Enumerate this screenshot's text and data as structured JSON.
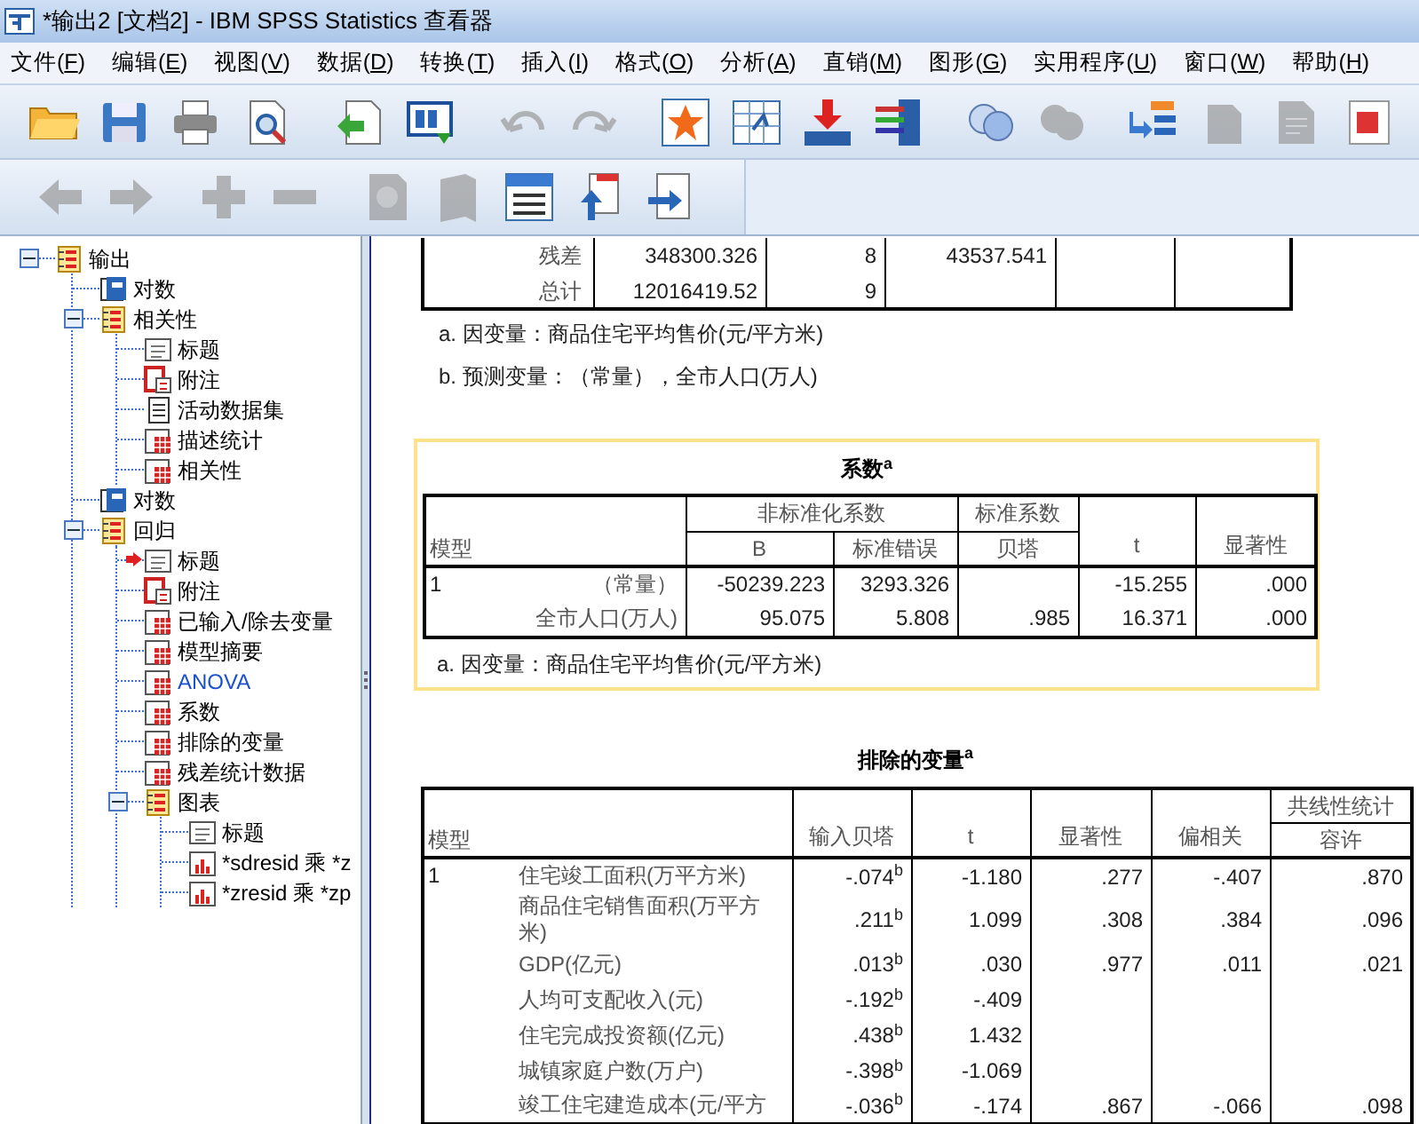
{
  "window": {
    "title": "*输出2 [文档2] - IBM SPSS Statistics 查看器"
  },
  "menu": [
    "文件(F)",
    "编辑(E)",
    "视图(V)",
    "数据(D)",
    "转换(T)",
    "插入(I)",
    "格式(O)",
    "分析(A)",
    "直销(M)",
    "图形(G)",
    "实用程序(U)",
    "窗口(W)",
    "帮助(H)"
  ],
  "toolbar_main": [
    {
      "disabled": false
    },
    {
      "disabled": false
    },
    {
      "disabled": false
    },
    {
      "disabled": false
    },
    {
      "disabled": false
    },
    {
      "disabled": false
    },
    {
      "disabled": true
    },
    {
      "disabled": true
    },
    {
      "disabled": false
    },
    {
      "disabled": false
    },
    {
      "disabled": false
    },
    {
      "disabled": false
    },
    {
      "disabled": false
    },
    {
      "disabled": true
    },
    {
      "disabled": false
    },
    {
      "disabled": true
    },
    {
      "disabled": true
    },
    {
      "disabled": false
    }
  ],
  "toolbar_nav": [
    {
      "disabled": true
    },
    {
      "disabled": true
    },
    {
      "disabled": true
    },
    {
      "disabled": true
    },
    {
      "disabled": true
    },
    {
      "disabled": true
    },
    {
      "disabled": false
    },
    {
      "disabled": false
    },
    {
      "disabled": false
    }
  ],
  "tree": [
    {
      "kind": "folder",
      "label": "输出",
      "expanded": true,
      "current": false,
      "highlighted": false,
      "children": [
        {
          "kind": "log",
          "label": "对数",
          "current": false,
          "highlighted": false
        },
        {
          "kind": "folder",
          "label": "相关性",
          "expanded": true,
          "current": false,
          "highlighted": false,
          "children": [
            {
              "kind": "title",
              "label": "标题",
              "current": false,
              "highlighted": false
            },
            {
              "kind": "notes",
              "label": "附注",
              "current": false,
              "highlighted": false
            },
            {
              "kind": "dataset",
              "label": "活动数据集",
              "current": false,
              "highlighted": false
            },
            {
              "kind": "table",
              "label": "描述统计",
              "current": false,
              "highlighted": false
            },
            {
              "kind": "table",
              "label": "相关性",
              "current": false,
              "highlighted": false
            }
          ]
        },
        {
          "kind": "log",
          "label": "对数",
          "current": false,
          "highlighted": false
        },
        {
          "kind": "folder",
          "label": "回归",
          "expanded": true,
          "current": false,
          "highlighted": false,
          "children": [
            {
              "kind": "title",
              "label": "标题",
              "current": true,
              "highlighted": false
            },
            {
              "kind": "notes",
              "label": "附注",
              "current": false,
              "highlighted": false
            },
            {
              "kind": "table",
              "label": "已输入/除去变量",
              "current": false,
              "highlighted": false
            },
            {
              "kind": "table",
              "label": "模型摘要",
              "current": false,
              "highlighted": false
            },
            {
              "kind": "table",
              "label": "ANOVA",
              "current": false,
              "highlighted": true
            },
            {
              "kind": "table",
              "label": "系数",
              "current": false,
              "highlighted": false
            },
            {
              "kind": "table",
              "label": "排除的变量",
              "current": false,
              "highlighted": false
            },
            {
              "kind": "table",
              "label": "残差统计数据",
              "current": false,
              "highlighted": false
            },
            {
              "kind": "folder",
              "label": "图表",
              "expanded": true,
              "current": false,
              "highlighted": false,
              "children": [
                {
                  "kind": "title",
                  "label": "标题",
                  "current": false,
                  "highlighted": false
                },
                {
                  "kind": "chart",
                  "label": "*sdresid 乘 *z",
                  "current": false,
                  "highlighted": false
                },
                {
                  "kind": "chart",
                  "label": "*zresid 乘 *zp",
                  "current": false,
                  "highlighted": false
                }
              ]
            }
          ]
        }
      ]
    }
  ],
  "anova": {
    "rows": [
      {
        "label": "残差",
        "cells": [
          "348300.326",
          "8",
          "43537.541"
        ]
      },
      {
        "label": "总计",
        "cells": [
          "12016419.52",
          "9"
        ]
      }
    ],
    "footnotes": [
      "a. 因变量：商品住宅平均售价(元/平方米)",
      "b. 预测变量：（常量），全市人口(万人)"
    ]
  },
  "coefficients": {
    "title": "系数$^{a}$",
    "selected": true,
    "model_header": "模型",
    "group_1": "非标准化系数",
    "group_2": "标准系数",
    "sub_headers": [
      "B",
      "标准错误",
      "贝塔"
    ],
    "t_header": "t",
    "sig_header": "显著性",
    "rows": [
      {
        "model": "1",
        "label": "（常量）",
        "cells": [
          "-50239.223",
          "3293.326",
          null,
          "-15.255",
          ".000"
        ]
      },
      {
        "label": "全市人口(万人)",
        "cells": [
          "95.075",
          "5.808",
          ".985",
          "16.371",
          ".000"
        ]
      }
    ],
    "footnote": "a. 因变量：商品住宅平均售价(元/平方米)"
  },
  "excluded": {
    "title": "排除的变量$^{a}$",
    "model_header": "模型",
    "headers": [
      "输入贝塔",
      "t",
      "显著性",
      "偏相关"
    ],
    "group": "共线性统计",
    "group_sub": "容许",
    "rows": [
      {
        "model": "1",
        "label": "住宅竣工面积(万平方米)",
        "cells": [
          "-.074$^{b}$",
          "-1.180",
          ".277",
          "-.407",
          ".870"
        ]
      },
      {
        "label": "商品住宅销售面积(万平方米)",
        "cells": [
          ".211$^{b}$",
          "1.099",
          ".308",
          ".384",
          ".096"
        ]
      },
      {
        "label": "GDP(亿元)",
        "cells": [
          ".013$^{b}$",
          ".030",
          ".977",
          ".011",
          ".021"
        ]
      },
      {
        "label": "人均可支配收入(元)",
        "cells": [
          "-.192$^{b}$",
          "-.409",
          null,
          null,
          null
        ]
      },
      {
        "label": "住宅完成投资额(亿元)",
        "cells": [
          ".438$^{b}$",
          "1.432",
          null,
          null,
          null
        ]
      },
      {
        "label": "城镇家庭户数(万户)",
        "cells": [
          "-.398$^{b}$",
          "-1.069",
          null,
          null,
          null
        ]
      },
      {
        "label": "竣工住宅建造成本(元/平方",
        "cells": [
          "-.036$^{b}$",
          "-.174",
          ".867",
          "-.066",
          ".098"
        ]
      }
    ]
  }
}
